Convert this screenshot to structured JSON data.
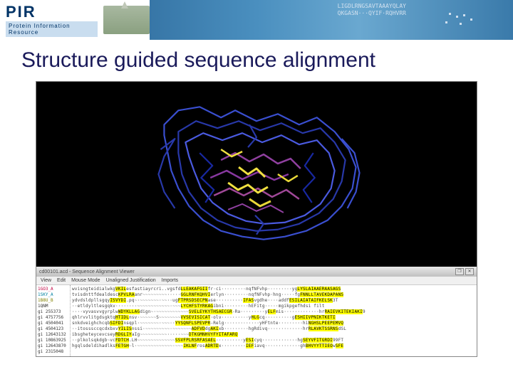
{
  "header": {
    "logo_main": "PIR",
    "logo_sub": "Protein Information Resource",
    "banner_seq_line1": "LIGDLRNGSAVTAAAYQLAY",
    "banner_seq_line2": "QKGASN···QYIF·RQHVRR"
  },
  "slide": {
    "title": "Structure guided sequence alignment"
  },
  "alignment_viewer": {
    "title": "cd00101.acd - Sequence Alignment Viewer",
    "menu": {
      "view": "View",
      "edit": "Edit",
      "mouse": "Mouse Mode",
      "unaligned": "Unaligned Justification",
      "imports": "Imports"
    },
    "controls": {
      "restore": "❐",
      "close": "✕"
    },
    "labels": [
      {
        "txt": "1GO3_A",
        "cls": "colored"
      },
      {
        "txt": "1SKY_A",
        "cls": "colored2"
      },
      {
        "txt": "1B8U_B",
        "cls": "colored3"
      },
      {
        "txt": "1QNM",
        "cls": ""
      },
      {
        "txt": "gi 255373",
        "cls": ""
      },
      {
        "txt": "gi 4757756",
        "cls": ""
      },
      {
        "txt": "gi 4504041",
        "cls": ""
      },
      {
        "txt": "gi 4504123",
        "cls": ""
      },
      {
        "txt": "gi 12643132",
        "cls": ""
      },
      {
        "txt": "gi 10863925",
        "cls": ""
      },
      {
        "txt": "gi 12643870",
        "cls": ""
      },
      {
        "txt": "gi 2315048",
        "cls": ""
      }
    ],
    "rows": [
      "wvisngteidialwkgVKILesfastiayrcri..vgsfdLLEAKAFGIIfr·ci·········nqfNFvhp·········ygLYSLAIAAERAASAGS",
      "tvisdnttfdealdescKPVLRAanr~~~~~~~~~·····GGLRNFKQHVIerlyn·········nqfNFvhp·hng·····fgFNNLLTAVEKDAPANS",
      "ydvdsldpllsgqyISVYDI.pq~·~~~~~~~·~~··ugFTPRSDSECPNase··········IFASvgdhe····addfESILAIATAIFKELSK3T",
      "··etldyltlesgqkv········~~~~~~~~~~~~·~~~LYCHFSTYRKAGibni·········hEFitg·····mgikpgefhdsi filt",
      "····vyvasvvgyrplwWDYKLLAGdign~·~~~~~~~~~~~~SVELEYKYTHSAECGR-Ra·········yELFmis·············hrRAIEVKITEKIAKI9",
      "qhlrvvlitgdsgktqHTIDLnsv·~~~~~~S~~~~~~~~VVSEVISICAT·olv··········yHLGcq··········gESHIIVPNIKTKETI",
      "snkdveighchcqbSIFDInsqpl·~~~~~~~·~~~··YYSQNFLSPEVPR-Relg·············yHFtnte·········hiNGHSLPEEPEMVQ",
      "··itosssccqcdxbxvYILISnssi·~~~~~~~~~·~~~~~~~ADFVDdgAKIxb·········hgRdivq·············hrRLAVKTSSRNSdSL",
      "ibsgheteycevcseyRDGLIYaIg~~~~~~~~~~·····~~~DTKGMNHVYFYITAFARQ",
      "··plkolsqkdgb~vcFDTCH.LH~~~~~~~~~~~~~~SSVFPLRSRFASAEL··········yESIcyq·············hgSEYVFITGRDI99FT",
      "hgqlsdeldihadlksFETGH~l·~~~~~~~~~~~~~·~~~IKLNFrosADRTDx·········IEFiavq·············ghBHVYYTTIEOwSFE"
    ]
  }
}
